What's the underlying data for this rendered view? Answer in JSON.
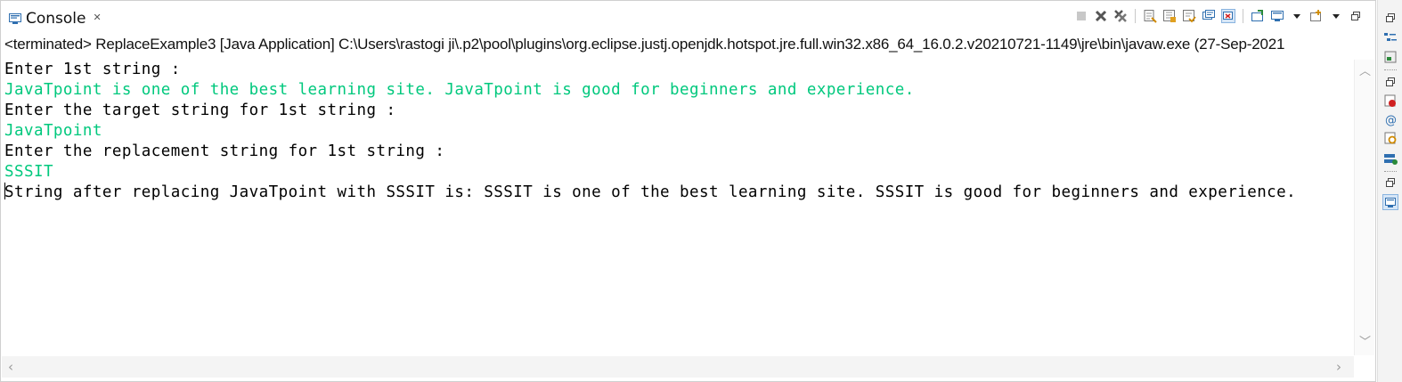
{
  "console": {
    "tab_label": "Console",
    "tab_close_glyph": "✕",
    "status_line": "<terminated> ReplaceExample3 [Java Application] C:\\Users\\rastogi ji\\.p2\\pool\\plugins\\org.eclipse.justj.openjdk.hotspot.jre.full.win32.x86_64_16.0.2.v20210721-1149\\jre\\bin\\javaw.exe  (27-Sep-2021",
    "lines": [
      {
        "kind": "stdout",
        "text": "Enter 1st string :"
      },
      {
        "kind": "stdin",
        "text": "JavaTpoint is one of the best learning site. JavaTpoint is good for beginners and experience."
      },
      {
        "kind": "stdout",
        "text": "Enter the target string for 1st string :"
      },
      {
        "kind": "stdin",
        "text": "JavaTpoint"
      },
      {
        "kind": "stdout",
        "text": "Enter the replacement string for 1st string :"
      },
      {
        "kind": "stdin",
        "text": "SSSIT"
      },
      {
        "kind": "stdout",
        "text": "String after replacing JavaTpoint with SSSIT is: SSSIT is one of the best learning site. SSSIT is good for beginners and experience."
      }
    ]
  },
  "toolbar_icons": [
    "terminate-icon",
    "remove-launch-icon",
    "remove-all-terminated-icon",
    "clear-console-icon",
    "scroll-lock-icon",
    "word-wrap-icon",
    "show-on-stdout-icon",
    "show-on-stderr-icon",
    "pin-console-icon",
    "display-selected-console-icon",
    "open-console-icon",
    "minimize-icon"
  ],
  "colors": {
    "stdout": "#000000",
    "stdin": "#00c87d",
    "accent": "#2f6fb0"
  }
}
